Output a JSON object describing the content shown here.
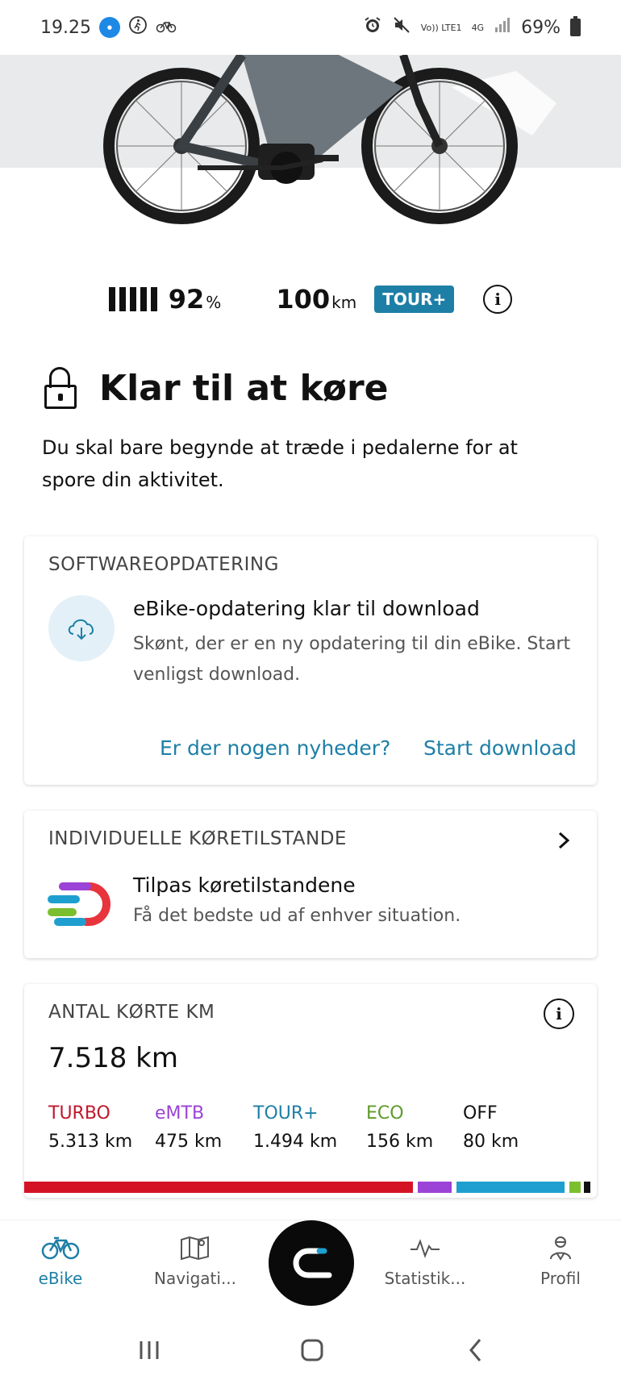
{
  "status_bar": {
    "time": "19.25",
    "network": "Vo)) LTE1",
    "signal_type": "4G",
    "battery_percent": "69%"
  },
  "bike_stats": {
    "battery_level": "92",
    "battery_unit": "%",
    "range_value": "100",
    "range_unit": "km",
    "mode": "TOUR+",
    "info_icon": "i"
  },
  "ready": {
    "title": "Klar til at køre",
    "subtitle": "Du skal bare begynde at træde i pedalerne for at spore din aktivitet."
  },
  "software_update": {
    "header": "SOFTWAREOPDATERING",
    "title": "eBike-opdatering klar til download",
    "description": "Skønt, der er en ny opdatering til din eBike. Start venligst download.",
    "link_news": "Er der nogen nyheder?",
    "link_download": "Start download"
  },
  "riding_modes": {
    "header": "INDIVIDUELLE KØRETILSTANDE",
    "title": "Tilpas køretilstandene",
    "description": "Få det bedste ud af enhver situation."
  },
  "distance": {
    "header": "ANTAL KØRTE KM",
    "total": "7.518 km",
    "modes": [
      {
        "name": "TURBO",
        "value": "5.313 km",
        "color": "#c0182c"
      },
      {
        "name": "eMTB",
        "value": "475 km",
        "color": "#9b43d6"
      },
      {
        "name": "TOUR+",
        "value": "1.494 km",
        "color": "#1e7fa6"
      },
      {
        "name": "ECO",
        "value": "156 km",
        "color": "#5f9b2a"
      },
      {
        "name": "OFF",
        "value": "80 km",
        "color": "#111111"
      }
    ]
  },
  "bottom_nav": {
    "items": [
      {
        "label": "eBike"
      },
      {
        "label": "Navigati..."
      },
      {
        "label": "Statistik..."
      },
      {
        "label": "Profil"
      }
    ]
  },
  "colors": {
    "accent": "#1e7fa6",
    "turbo": "#d41424",
    "emtb": "#9b43d6",
    "tour": "#1e9fd0",
    "eco": "#7bbf2e",
    "off": "#111111"
  }
}
